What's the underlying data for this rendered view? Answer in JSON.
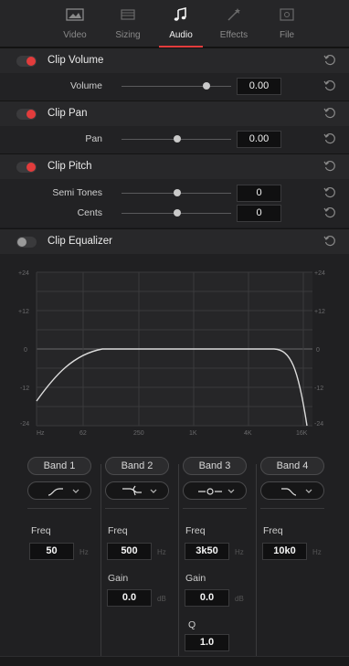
{
  "tabs": [
    {
      "label": "Video",
      "icon": "video-icon",
      "active": false
    },
    {
      "label": "Sizing",
      "icon": "sizing-icon",
      "active": false
    },
    {
      "label": "Audio",
      "icon": "audio-note-icon",
      "active": true
    },
    {
      "label": "Effects",
      "icon": "effects-wand-icon",
      "active": false
    },
    {
      "label": "File",
      "icon": "file-icon",
      "active": false
    }
  ],
  "clip_volume": {
    "title": "Clip Volume",
    "enabled": true,
    "volume_label": "Volume",
    "volume_value": "0.00"
  },
  "clip_pan": {
    "title": "Clip Pan",
    "enabled": true,
    "pan_label": "Pan",
    "pan_value": "0.00"
  },
  "clip_pitch": {
    "title": "Clip Pitch",
    "enabled": true,
    "semitones_label": "Semi Tones",
    "semitones_value": "0",
    "cents_label": "Cents",
    "cents_value": "0"
  },
  "clip_equalizer": {
    "title": "Clip Equalizer",
    "enabled": false,
    "graph": {
      "y_ticks_left": [
        "+24",
        "+12",
        "0",
        "-12",
        "-24"
      ],
      "y_ticks_right": [
        "+24",
        "+12",
        "0",
        "-12",
        "-24"
      ],
      "x_ticks": [
        "Hz",
        "62",
        "250",
        "1K",
        "4K",
        "16K"
      ]
    },
    "bands": [
      {
        "label": "Band 1",
        "shape_icon": "low-shelf-icon",
        "freq_label": "Freq",
        "freq_value": "50",
        "freq_unit": "Hz"
      },
      {
        "label": "Band 2",
        "shape_icon": "bell-low-icon",
        "freq_label": "Freq",
        "freq_value": "500",
        "freq_unit": "Hz",
        "gain_label": "Gain",
        "gain_value": "0.0",
        "gain_unit": "dB"
      },
      {
        "label": "Band 3",
        "shape_icon": "bell-icon",
        "freq_label": "Freq",
        "freq_value": "3k50",
        "freq_unit": "Hz",
        "gain_label": "Gain",
        "gain_value": "0.0",
        "gain_unit": "dB",
        "q_label": "Q",
        "q_value": "1.0"
      },
      {
        "label": "Band 4",
        "shape_icon": "high-shelf-icon",
        "freq_label": "Freq",
        "freq_value": "10k0",
        "freq_unit": "Hz"
      }
    ]
  },
  "colors": {
    "accent": "#e23c3c",
    "panel": "#222224",
    "header": "#28282a"
  }
}
